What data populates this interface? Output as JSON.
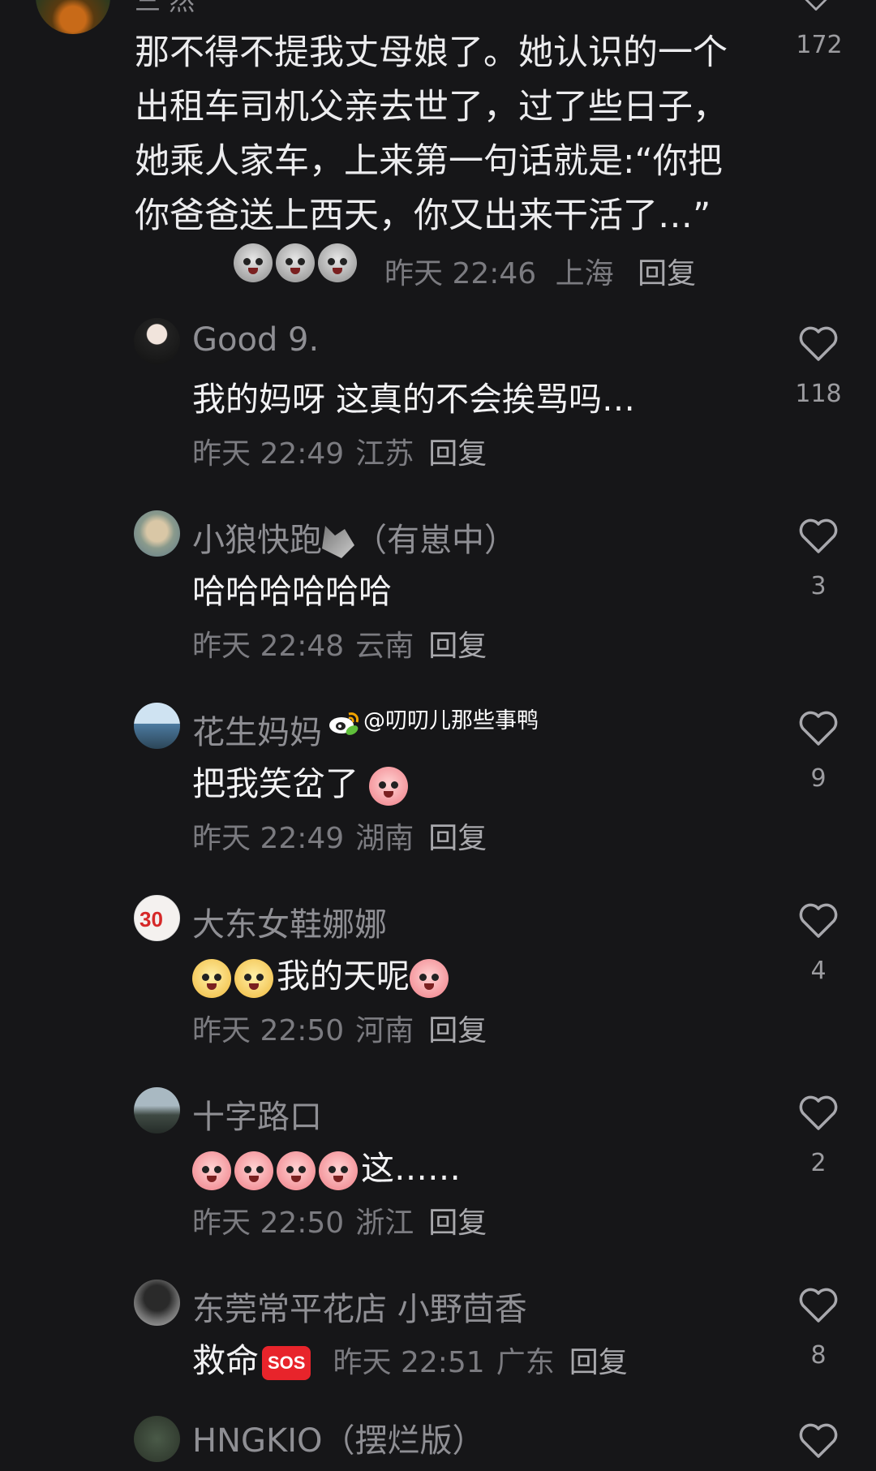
{
  "top_comment": {
    "name": "三 然",
    "text": "那不得不提我丈母娘了。她认识的一个出租车司机父亲去世了，过了些日子，她乘人家车，上来第一句话就是:“你把你爸爸送上西天，你又出来干活了…”",
    "time": "昨天 22:46",
    "location": "上海",
    "reply_label": "回复",
    "likes": "172"
  },
  "comments": [
    {
      "name": "Good 9.",
      "text": "我的妈呀 这真的不会挨骂吗…",
      "time": "昨天 22:49",
      "location": "江苏",
      "reply_label": "回复",
      "likes": "118"
    },
    {
      "name": "小狼快跑",
      "name_suffix": "（有崽中）",
      "text": "哈哈哈哈哈哈",
      "time": "昨天 22:48",
      "location": "云南",
      "reply_label": "回复",
      "likes": "3"
    },
    {
      "name": "花生妈妈",
      "text": "把我笑岔了",
      "time": "昨天 22:49",
      "location": "湖南",
      "reply_label": "回复",
      "likes": "9"
    },
    {
      "name": "大东女鞋娜娜",
      "text": "我的天呢",
      "time": "昨天 22:50",
      "location": "河南",
      "reply_label": "回复",
      "likes": "4"
    },
    {
      "name": "十字路口",
      "text": "这……",
      "time": "昨天 22:50",
      "location": "浙江",
      "reply_label": "回复",
      "likes": "2"
    },
    {
      "name": "东莞常平花店 小野茴香",
      "text": "救命",
      "sos_label": "SOS",
      "time": "昨天 22:51",
      "location": "广东",
      "reply_label": "回复",
      "likes": "8"
    }
  ],
  "bottom_comment": {
    "name": "HNGKIO（摆烂版）"
  },
  "avatar_badge": "30",
  "watermark": "@叨叨儿那些事鸭",
  "icons": {
    "like": "heart-outline-icon",
    "watermark": "weibo-icon"
  },
  "colors": {
    "background": "#161618",
    "text": "#f2f2f4",
    "meta": "#7b7b80",
    "sos": "#e8242b"
  }
}
